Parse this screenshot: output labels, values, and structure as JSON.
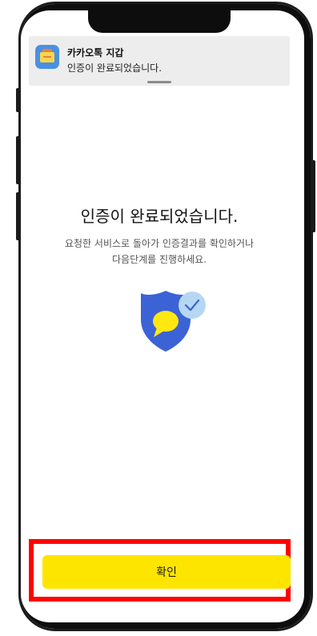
{
  "notification": {
    "app_name": "카카오톡 지갑",
    "message": "인증이 완료되었습니다.",
    "icon": "kakao-wallet-app-icon"
  },
  "main": {
    "title": "인증이 완료되었습니다.",
    "subtitle_line1": "요청한 서비스로 돌아가 인증결과를 확인하거나",
    "subtitle_line2": "다음단계를 진행하세요.",
    "illustration_icon": "shield-check-icon"
  },
  "footer": {
    "confirm_label": "확인"
  },
  "colors": {
    "accent_yellow": "#FEE500",
    "shield_blue": "#3B63D6",
    "check_badge": "#B6D7F2",
    "highlight_red": "#FF0000"
  }
}
